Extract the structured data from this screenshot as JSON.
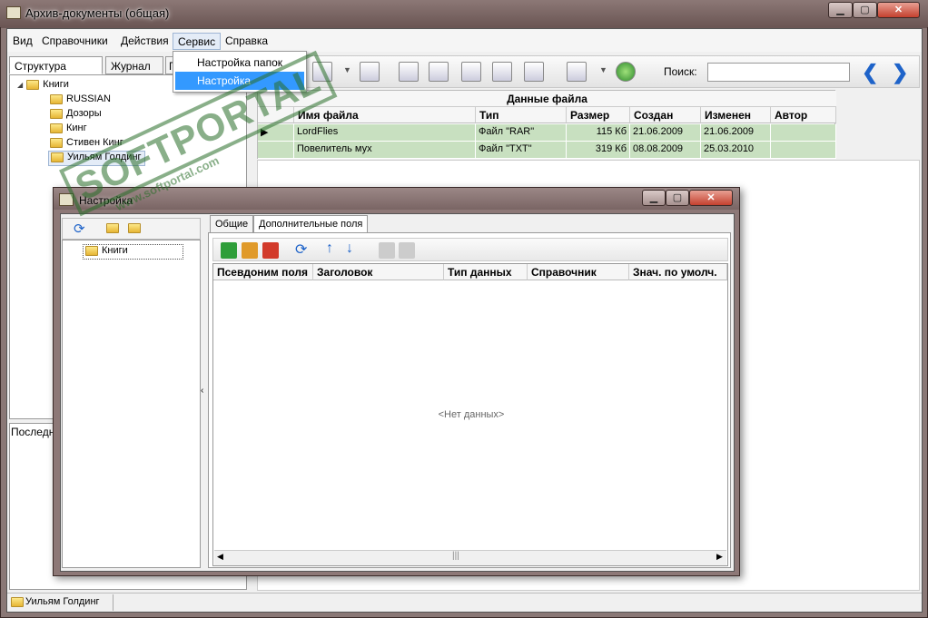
{
  "window": {
    "title": "Архив-документы (общая)"
  },
  "menu": {
    "items": [
      "Вид",
      "Справочники",
      "Действия",
      "Сервис",
      "Справка"
    ],
    "dropdown": [
      "Настройка папок",
      "Настройка"
    ]
  },
  "left_tabs": [
    "Структура папок",
    "Журнал",
    "Г"
  ],
  "tree": {
    "root": "Книги",
    "children": [
      "RUSSIAN",
      "Дозоры",
      "Кинг",
      "Стивен Кинг",
      "Уильям Голдинг"
    ]
  },
  "lower_tab": "Последни",
  "search": {
    "label": "Поиск:"
  },
  "grid": {
    "title": "Данные файла",
    "columns": [
      "Имя файла",
      "Тип",
      "Размер",
      "Создан",
      "Изменен",
      "Автор"
    ],
    "rows": [
      [
        "LordFlies",
        "Файл \"RAR\"",
        "115 Кб",
        "21.06.2009",
        "21.06.2009",
        ""
      ],
      [
        "Повелитель мух",
        "Файл \"TXT\"",
        "319 Кб",
        "08.08.2009",
        "25.03.2010",
        ""
      ]
    ]
  },
  "status": {
    "text": "Уильям Голдинг"
  },
  "dialog": {
    "title": "Настройка",
    "tree_root": "Книги",
    "tabs": [
      "Общие",
      "Дополнительные поля"
    ],
    "columns": [
      "Псевдоним поля",
      "Заголовок",
      "Тип данных",
      "Справочник",
      "Знач. по умолч."
    ],
    "empty_text": "<Нет данных>"
  },
  "watermark": {
    "brand": "SOFTPORTAL",
    "url": "www.softportal.com"
  }
}
